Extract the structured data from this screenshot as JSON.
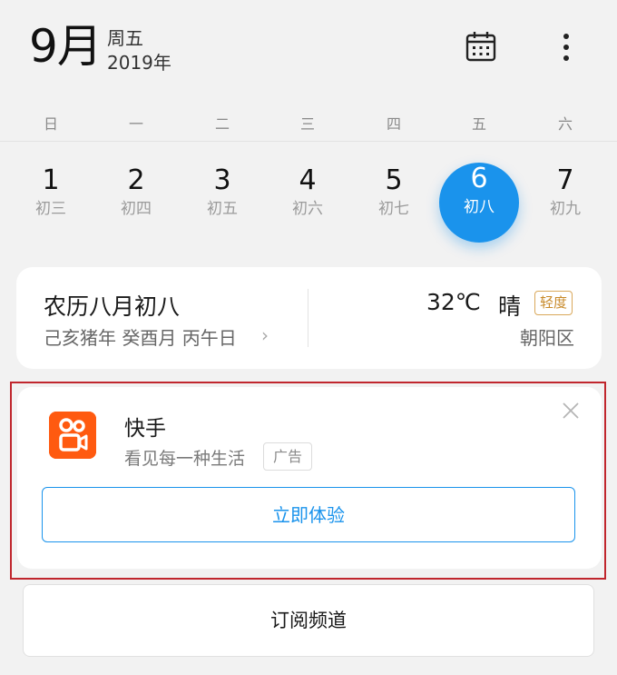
{
  "header": {
    "month": "9月",
    "weekday": "周五",
    "year": "2019年",
    "calendar_icon": "calendar-icon",
    "more_icon": "more-vertical-icon"
  },
  "week": {
    "days": [
      "日",
      "一",
      "二",
      "三",
      "四",
      "五",
      "六"
    ],
    "dates": [
      {
        "num": "1",
        "lunar": "初三"
      },
      {
        "num": "2",
        "lunar": "初四"
      },
      {
        "num": "3",
        "lunar": "初五"
      },
      {
        "num": "4",
        "lunar": "初六"
      },
      {
        "num": "5",
        "lunar": "初七"
      },
      {
        "num": "6",
        "lunar": "初八"
      },
      {
        "num": "7",
        "lunar": "初九"
      }
    ],
    "selected_color": "#1a93ec"
  },
  "info": {
    "lunar_date": "农历八月初八",
    "ganzhi": "己亥猪年 癸酉月 丙午日",
    "temperature": "32℃",
    "weather": "晴",
    "air_quality": "轻度",
    "district": "朝阳区"
  },
  "ad": {
    "app_name": "快手",
    "description": "看见每一种生活",
    "ad_tag": "广告",
    "cta": "立即体验",
    "logo_color": "#ff5a10",
    "close_icon": "close-icon"
  },
  "subscribe": {
    "label": "订阅频道"
  }
}
